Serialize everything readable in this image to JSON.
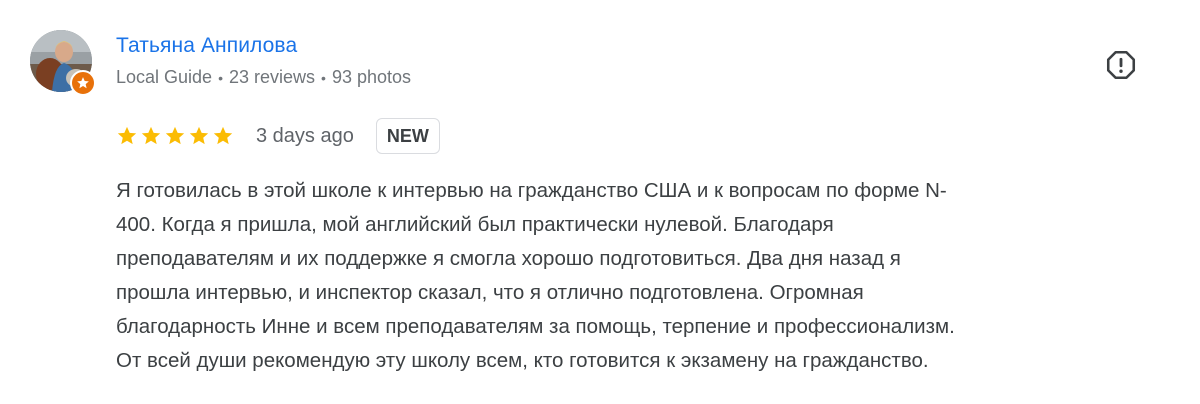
{
  "reviewer": {
    "name": "Татьяна Анпилова",
    "meta": {
      "guide": "Local Guide",
      "reviews": "23 reviews",
      "photos": "93 photos"
    },
    "avatar_icon": "user-photo",
    "badge_icon": "local-guide-star-icon"
  },
  "review": {
    "rating": 5,
    "rating_max": 5,
    "date": "3 days ago",
    "new_badge": "NEW",
    "text_lines": [
      "Я готовилась в этой школе к интервью на гражданство США и к вопросам по форме N-",
      "400. Когда я пришла, мой английский был практически нулевой. Благодаря",
      "преподавателям и их поддержке я смогла хорошо подготовиться. Два дня назад я",
      "прошла интервью, и инспектор сказал, что я отлично подготовлена. Огромная",
      "благодарность Инне и всем преподавателям за помощь, терпение и профессионализм.",
      "От всей души рекомендую эту школу всем, кто готовится к экзамену на гражданство."
    ]
  },
  "actions": {
    "report_icon": "report-icon"
  },
  "colors": {
    "name": "#1a73e8",
    "meta": "#70757a",
    "star": "#fbbc04",
    "text": "#3c4043",
    "badge": "#e8710a"
  }
}
